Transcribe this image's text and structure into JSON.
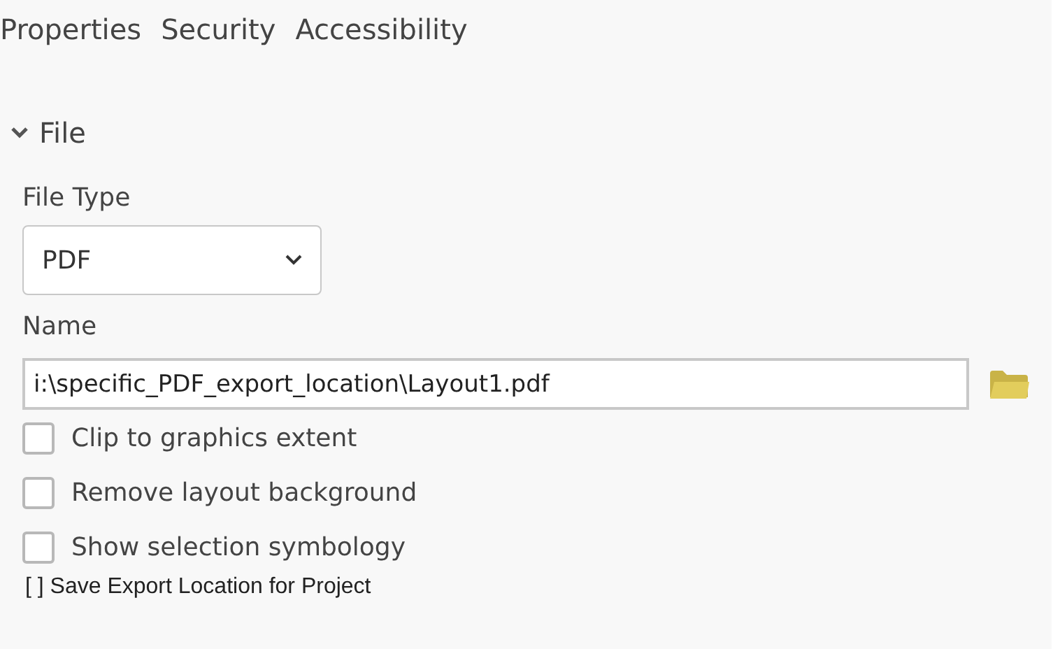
{
  "tabs": [
    {
      "label": "Properties"
    },
    {
      "label": "Security"
    },
    {
      "label": "Accessibility"
    }
  ],
  "section": {
    "title": "File",
    "expanded": true
  },
  "file_type": {
    "label": "File Type",
    "value": "PDF"
  },
  "name": {
    "label": "Name",
    "value": "i:\\specific_PDF_export_location\\Layout1.pdf"
  },
  "options": [
    {
      "label": "Clip to graphics extent",
      "checked": false
    },
    {
      "label": "Remove layout background",
      "checked": false
    },
    {
      "label": "Show selection symbology",
      "checked": false
    }
  ],
  "note": "[ ] Save Export Location for Project"
}
